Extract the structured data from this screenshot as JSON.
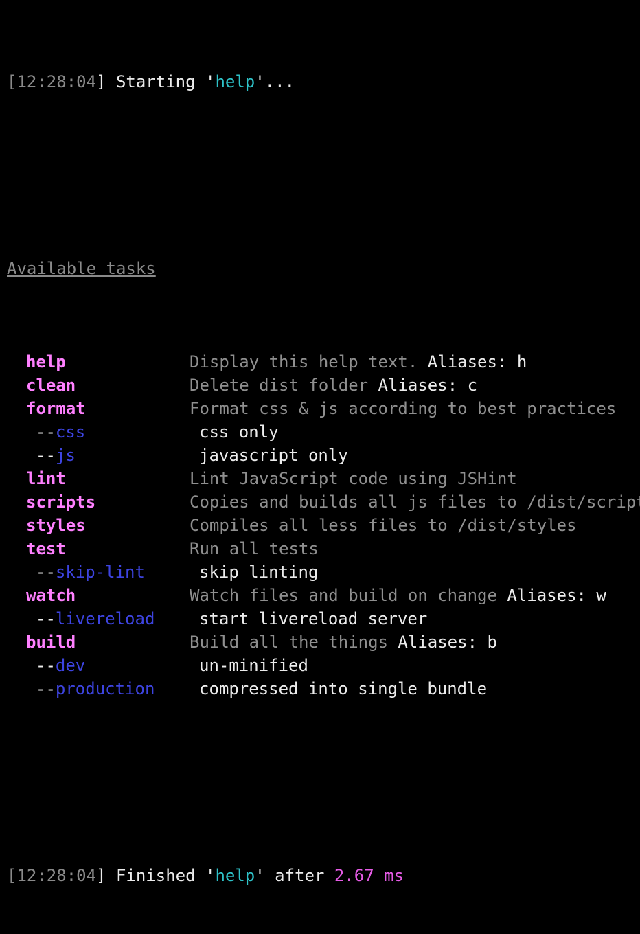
{
  "start_line": {
    "bracket_open": "[",
    "time": "12:28:04",
    "bracket_close": "]",
    "text_before": " Starting '",
    "task": "help",
    "text_after": "'..."
  },
  "heading": "Available tasks",
  "tasks": [
    {
      "kind": "task",
      "name": "help",
      "desc": "Display this help text.",
      "alias": " Aliases: h"
    },
    {
      "kind": "task",
      "name": "clean",
      "desc": "Delete dist folder",
      "alias": " Aliases: c"
    },
    {
      "kind": "task",
      "name": "format",
      "desc": "Format css & js according to best practices",
      "alias": ""
    },
    {
      "kind": "flag",
      "prefix": "--",
      "name": "css",
      "desc": "css only"
    },
    {
      "kind": "flag",
      "prefix": "--",
      "name": "js",
      "desc": "javascript only"
    },
    {
      "kind": "task",
      "name": "lint",
      "desc": "Lint JavaScript code using JSHint",
      "alias": ""
    },
    {
      "kind": "task",
      "name": "scripts",
      "desc": "Copies and builds all js files to /dist/scripts",
      "alias": ""
    },
    {
      "kind": "task",
      "name": "styles",
      "desc": "Compiles all less files to /dist/styles",
      "alias": ""
    },
    {
      "kind": "task",
      "name": "test",
      "desc": "Run all tests",
      "alias": ""
    },
    {
      "kind": "flag",
      "prefix": "--",
      "name": "skip-lint",
      "desc": "skip linting"
    },
    {
      "kind": "task",
      "name": "watch",
      "desc": "Watch files and build on change",
      "alias": " Aliases: w"
    },
    {
      "kind": "flag",
      "prefix": "--",
      "name": "livereload",
      "desc": "start livereload server"
    },
    {
      "kind": "task",
      "name": "build",
      "desc": "Build all the things",
      "alias": " Aliases: b"
    },
    {
      "kind": "flag",
      "prefix": "--",
      "name": "dev",
      "desc": "un-minified"
    },
    {
      "kind": "flag",
      "prefix": "--",
      "name": "production",
      "desc": "compressed into single bundle"
    }
  ],
  "finish_line": {
    "bracket_open": "[",
    "time": "12:28:04",
    "bracket_close": "]",
    "text_before": " Finished '",
    "task": "help",
    "text_mid": "' after ",
    "duration": "2.67 ms"
  },
  "colors": {
    "background": "#000000",
    "timestamp": "#8a8a8a",
    "task_name": "#ff80ff",
    "flag_name": "#3d44e0",
    "highlight_cyan": "#2ec2c8",
    "description_dim": "#8f8f8f",
    "text_white": "#ececec"
  }
}
